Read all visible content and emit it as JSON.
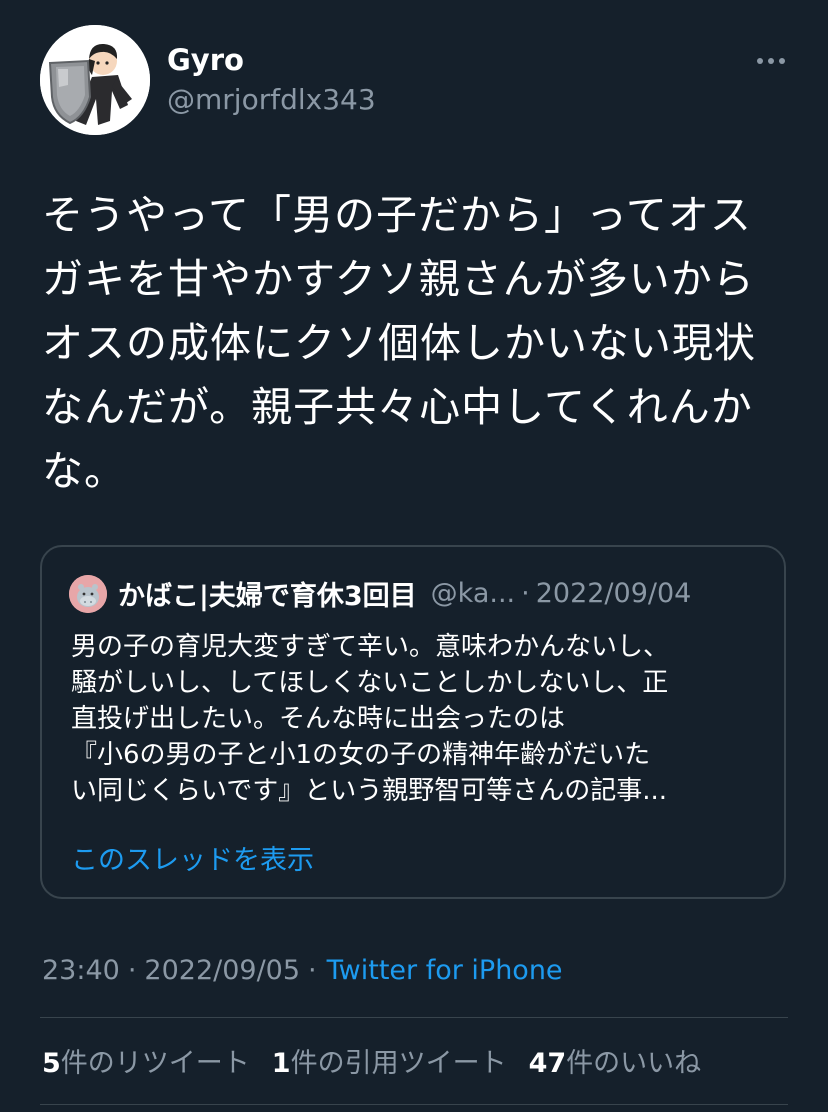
{
  "author": {
    "display_name": "Gyro",
    "handle": "@mrjorfdlx343",
    "avatar_icon": "person-with-shield-avatar"
  },
  "tweet": {
    "text_lines": [
      "そうやって「男の子だから」ってオス",
      "ガキを甘やかすクソ親さんが多いから",
      "オスの成体にクソ個体しかいない現状",
      "なんだが。親子共々心中してくれんか",
      "な。"
    ],
    "time": "23:40",
    "date": "2022/09/05",
    "source": "Twitter for iPhone"
  },
  "quoted_tweet": {
    "display_name": "かばこ|夫婦で育休3回目",
    "handle": "@ka...",
    "separator": "·",
    "date": "2022/09/04",
    "avatar_icon": "hippo-avatar",
    "text_lines": [
      "男の子の育児大変すぎて辛い。意味わかんないし、",
      "騒がしいし、してほしくないことしかしないし、正",
      "直投げ出したい。そんな時に出会ったのは",
      "『小6の男の子と小1の女の子の精神年齢がだいた",
      "い同じくらいです』という親野智可等さんの記事..."
    ],
    "show_thread_label": "このスレッドを表示"
  },
  "meta": {
    "separator": "·"
  },
  "stats": {
    "retweets": {
      "count": "5",
      "label": "件のリツイート"
    },
    "quotes": {
      "count": "1",
      "label": "件の引用ツイート"
    },
    "likes": {
      "count": "47",
      "label": "件のいいね"
    }
  },
  "colors": {
    "background": "#15202b",
    "text_primary": "#ffffff",
    "text_secondary": "#8b98a5",
    "link": "#1d9bf0",
    "border": "#38444d"
  }
}
